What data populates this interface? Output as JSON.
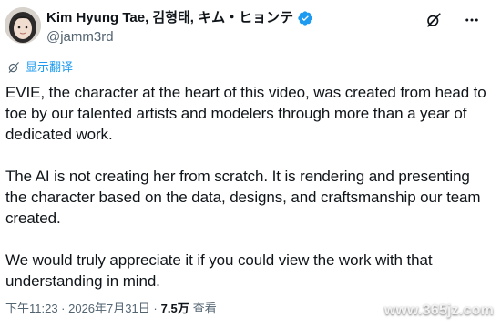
{
  "author": {
    "name": "Kim Hyung Tae, 김형태, キム・ヒョンテ",
    "handle": "@jamm3rd",
    "verified": true
  },
  "translate_label": "显示翻译",
  "tweet": {
    "paragraphs": [
      "EVIE, the character at the heart of this video, was created from head to toe by our talented artists and modelers through more than a year of dedicated work.",
      "The AI is not creating her from scratch. It is rendering and presenting the character based on the data, designs, and craftsmanship our team created.",
      "We would truly appreciate it if you could view the work with that understanding in mind."
    ]
  },
  "meta": {
    "time_date": "下午11:23 · 2026年7月31日 ·",
    "views_count": "7.5万",
    "views_label": "查看"
  },
  "watermark": "www.365jz.com",
  "colors": {
    "text": "#0f1419",
    "secondary": "#536471",
    "accent": "#1d9bf0"
  },
  "icons": [
    "verified-badge-icon",
    "grok-icon",
    "more-icon",
    "translate-icon"
  ]
}
